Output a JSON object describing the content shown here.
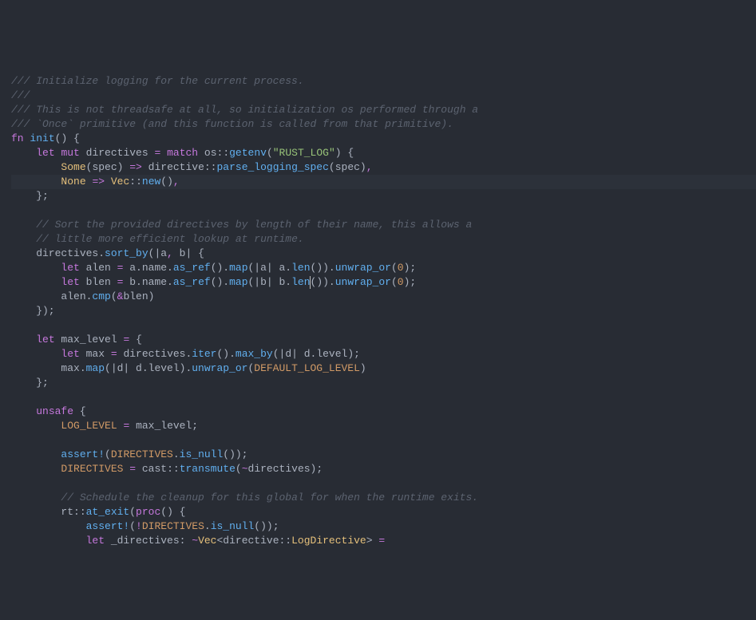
{
  "theme": {
    "bg": "#282c34",
    "fg": "#abb2bf",
    "comment": "#5c6370",
    "keyword": "#c678dd",
    "function": "#61afef",
    "type": "#e5c07b",
    "string": "#98c379",
    "number": "#d19a66",
    "constant": "#d19a66",
    "highlight_line_bg": "#2c313a"
  },
  "highlighted_line_index": 7,
  "cursor": {
    "line_index": 14,
    "col": 48
  },
  "code_lines": [
    {
      "tokens": [
        [
          "comment",
          "/// Initialize logging for the current process."
        ]
      ]
    },
    {
      "tokens": [
        [
          "comment",
          "///"
        ]
      ]
    },
    {
      "tokens": [
        [
          "comment",
          "/// This is not threadsafe at all, so initialization os performed through a"
        ]
      ]
    },
    {
      "tokens": [
        [
          "comment",
          "/// `Once` primitive (and this function is called from that primitive)."
        ]
      ]
    },
    {
      "tokens": [
        [
          "keyword",
          "fn"
        ],
        [
          "plain",
          " "
        ],
        [
          "func",
          "init"
        ],
        [
          "punct",
          "() {"
        ]
      ]
    },
    {
      "tokens": [
        [
          "plain",
          "    "
        ],
        [
          "keyword",
          "let"
        ],
        [
          "plain",
          " "
        ],
        [
          "keyword",
          "mut"
        ],
        [
          "plain",
          " directives "
        ],
        [
          "op",
          "="
        ],
        [
          "plain",
          " "
        ],
        [
          "keyword",
          "match"
        ],
        [
          "plain",
          " os"
        ],
        [
          "punct",
          "::"
        ],
        [
          "func",
          "getenv"
        ],
        [
          "punct",
          "("
        ],
        [
          "string",
          "\"RUST_LOG\""
        ],
        [
          "punct",
          ") {"
        ]
      ]
    },
    {
      "tokens": [
        [
          "plain",
          "        "
        ],
        [
          "type",
          "Some"
        ],
        [
          "punct",
          "(spec) "
        ],
        [
          "op",
          "=>"
        ],
        [
          "plain",
          " directive"
        ],
        [
          "punct",
          "::"
        ],
        [
          "func",
          "parse_logging_spec"
        ],
        [
          "punct",
          "(spec)"
        ],
        [
          "op",
          ","
        ]
      ]
    },
    {
      "tokens": [
        [
          "plain",
          "        "
        ],
        [
          "type",
          "None"
        ],
        [
          "plain",
          " "
        ],
        [
          "op",
          "=>"
        ],
        [
          "plain",
          " "
        ],
        [
          "type",
          "Vec"
        ],
        [
          "punct",
          "::"
        ],
        [
          "func",
          "new"
        ],
        [
          "punct",
          "()"
        ],
        [
          "op",
          ","
        ]
      ]
    },
    {
      "tokens": [
        [
          "plain",
          "    }"
        ],
        [
          "punct",
          ";"
        ]
      ]
    },
    {
      "tokens": [
        [
          "plain",
          ""
        ]
      ]
    },
    {
      "tokens": [
        [
          "plain",
          "    "
        ],
        [
          "comment",
          "// Sort the provided directives by length of their name, this allows a"
        ]
      ]
    },
    {
      "tokens": [
        [
          "plain",
          "    "
        ],
        [
          "comment",
          "// little more efficient lookup at runtime."
        ]
      ]
    },
    {
      "tokens": [
        [
          "plain",
          "    directives."
        ],
        [
          "func",
          "sort_by"
        ],
        [
          "punct",
          "(|a"
        ],
        [
          "op",
          ","
        ],
        [
          "plain",
          " b"
        ],
        [
          "punct",
          "| {"
        ]
      ]
    },
    {
      "tokens": [
        [
          "plain",
          "        "
        ],
        [
          "keyword",
          "let"
        ],
        [
          "plain",
          " alen "
        ],
        [
          "op",
          "="
        ],
        [
          "plain",
          " a.name."
        ],
        [
          "func",
          "as_ref"
        ],
        [
          "punct",
          "()."
        ],
        [
          "func",
          "map"
        ],
        [
          "punct",
          "(|a| a."
        ],
        [
          "func",
          "len"
        ],
        [
          "punct",
          "())."
        ],
        [
          "func",
          "unwrap_or"
        ],
        [
          "punct",
          "("
        ],
        [
          "num",
          "0"
        ],
        [
          "punct",
          ");"
        ]
      ]
    },
    {
      "tokens": [
        [
          "plain",
          "        "
        ],
        [
          "keyword",
          "let"
        ],
        [
          "plain",
          " blen "
        ],
        [
          "op",
          "="
        ],
        [
          "plain",
          " b.name."
        ],
        [
          "func",
          "as_ref"
        ],
        [
          "punct",
          "()."
        ],
        [
          "func",
          "map"
        ],
        [
          "punct",
          "(|b| b."
        ],
        [
          "func",
          "len"
        ],
        [
          "punct",
          "())."
        ],
        [
          "func",
          "unwrap_or"
        ],
        [
          "punct",
          "("
        ],
        [
          "num",
          "0"
        ],
        [
          "punct",
          ");"
        ]
      ]
    },
    {
      "tokens": [
        [
          "plain",
          "        alen."
        ],
        [
          "func",
          "cmp"
        ],
        [
          "punct",
          "("
        ],
        [
          "op",
          "&"
        ],
        [
          "plain",
          "blen"
        ],
        [
          "punct",
          ")"
        ]
      ]
    },
    {
      "tokens": [
        [
          "plain",
          "    });"
        ]
      ]
    },
    {
      "tokens": [
        [
          "plain",
          ""
        ]
      ]
    },
    {
      "tokens": [
        [
          "plain",
          "    "
        ],
        [
          "keyword",
          "let"
        ],
        [
          "plain",
          " max_level "
        ],
        [
          "op",
          "="
        ],
        [
          "plain",
          " {"
        ]
      ]
    },
    {
      "tokens": [
        [
          "plain",
          "        "
        ],
        [
          "keyword",
          "let"
        ],
        [
          "plain",
          " max "
        ],
        [
          "op",
          "="
        ],
        [
          "plain",
          " directives."
        ],
        [
          "func",
          "iter"
        ],
        [
          "punct",
          "()."
        ],
        [
          "func",
          "max_by"
        ],
        [
          "punct",
          "(|d| d.level)"
        ],
        [
          "punct",
          ";"
        ]
      ]
    },
    {
      "tokens": [
        [
          "plain",
          "        max."
        ],
        [
          "func",
          "map"
        ],
        [
          "punct",
          "(|d| d.level)."
        ],
        [
          "func",
          "unwrap_or"
        ],
        [
          "punct",
          "("
        ],
        [
          "const",
          "DEFAULT_LOG_LEVEL"
        ],
        [
          "punct",
          ")"
        ]
      ]
    },
    {
      "tokens": [
        [
          "plain",
          "    };"
        ]
      ]
    },
    {
      "tokens": [
        [
          "plain",
          ""
        ]
      ]
    },
    {
      "tokens": [
        [
          "plain",
          "    "
        ],
        [
          "keyword",
          "unsafe"
        ],
        [
          "plain",
          " {"
        ]
      ]
    },
    {
      "tokens": [
        [
          "plain",
          "        "
        ],
        [
          "const",
          "LOG_LEVEL"
        ],
        [
          "plain",
          " "
        ],
        [
          "op",
          "="
        ],
        [
          "plain",
          " max_level"
        ],
        [
          "punct",
          ";"
        ]
      ]
    },
    {
      "tokens": [
        [
          "plain",
          ""
        ]
      ]
    },
    {
      "tokens": [
        [
          "plain",
          "        "
        ],
        [
          "func",
          "assert!"
        ],
        [
          "punct",
          "("
        ],
        [
          "const",
          "DIRECTIVES"
        ],
        [
          "punct",
          "."
        ],
        [
          "func",
          "is_null"
        ],
        [
          "punct",
          "());"
        ]
      ]
    },
    {
      "tokens": [
        [
          "plain",
          "        "
        ],
        [
          "const",
          "DIRECTIVES"
        ],
        [
          "plain",
          " "
        ],
        [
          "op",
          "="
        ],
        [
          "plain",
          " cast"
        ],
        [
          "punct",
          "::"
        ],
        [
          "func",
          "transmute"
        ],
        [
          "punct",
          "("
        ],
        [
          "op",
          "~"
        ],
        [
          "plain",
          "directives"
        ],
        [
          "punct",
          ");"
        ]
      ]
    },
    {
      "tokens": [
        [
          "plain",
          ""
        ]
      ]
    },
    {
      "tokens": [
        [
          "plain",
          "        "
        ],
        [
          "comment",
          "// Schedule the cleanup for this global for when the runtime exits."
        ]
      ]
    },
    {
      "tokens": [
        [
          "plain",
          "        rt"
        ],
        [
          "punct",
          "::"
        ],
        [
          "func",
          "at_exit"
        ],
        [
          "punct",
          "("
        ],
        [
          "keyword",
          "proc"
        ],
        [
          "punct",
          "() {"
        ]
      ]
    },
    {
      "tokens": [
        [
          "plain",
          "            "
        ],
        [
          "func",
          "assert!"
        ],
        [
          "punct",
          "("
        ],
        [
          "op",
          "!"
        ],
        [
          "const",
          "DIRECTIVES"
        ],
        [
          "punct",
          "."
        ],
        [
          "func",
          "is_null"
        ],
        [
          "punct",
          "());"
        ]
      ]
    },
    {
      "tokens": [
        [
          "plain",
          "            "
        ],
        [
          "keyword",
          "let"
        ],
        [
          "plain",
          " _directives"
        ],
        [
          "punct",
          ": "
        ],
        [
          "op",
          "~"
        ],
        [
          "type",
          "Vec"
        ],
        [
          "punct",
          "<directive::"
        ],
        [
          "type",
          "LogDirective"
        ],
        [
          "punct",
          "> "
        ],
        [
          "op",
          "="
        ]
      ]
    }
  ]
}
